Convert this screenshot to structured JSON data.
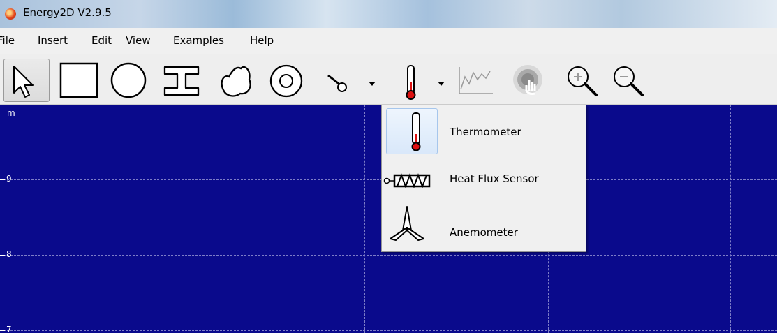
{
  "window": {
    "title": "Energy2D V2.9.5"
  },
  "menubar": {
    "items": [
      "File",
      "Insert",
      "Edit",
      "View",
      "Examples",
      "Help"
    ]
  },
  "toolbar": {
    "tools": [
      {
        "icon": "select-arrow-icon",
        "selected": true
      },
      {
        "icon": "rectangle-icon"
      },
      {
        "icon": "ellipse-icon"
      },
      {
        "icon": "i-beam-shape-icon"
      },
      {
        "icon": "blob-shape-icon"
      },
      {
        "icon": "ring-shape-icon"
      },
      {
        "icon": "particle-feeder-icon"
      },
      {
        "icon": "thermometer-icon"
      },
      {
        "icon": "graph-icon"
      },
      {
        "icon": "heating-hand-icon"
      },
      {
        "icon": "zoom-in-icon"
      },
      {
        "icon": "zoom-out-icon"
      }
    ]
  },
  "canvas": {
    "background": "#0a0a8c",
    "axis_unit": "m",
    "y_ticks": [
      "9",
      "8",
      "7"
    ]
  },
  "sensor_menu": {
    "items": [
      {
        "label": "Thermometer",
        "icon": "thermometer-icon"
      },
      {
        "label": "Heat Flux Sensor",
        "icon": "heat-flux-sensor-icon"
      },
      {
        "label": "Anemometer",
        "icon": "anemometer-icon"
      }
    ]
  }
}
